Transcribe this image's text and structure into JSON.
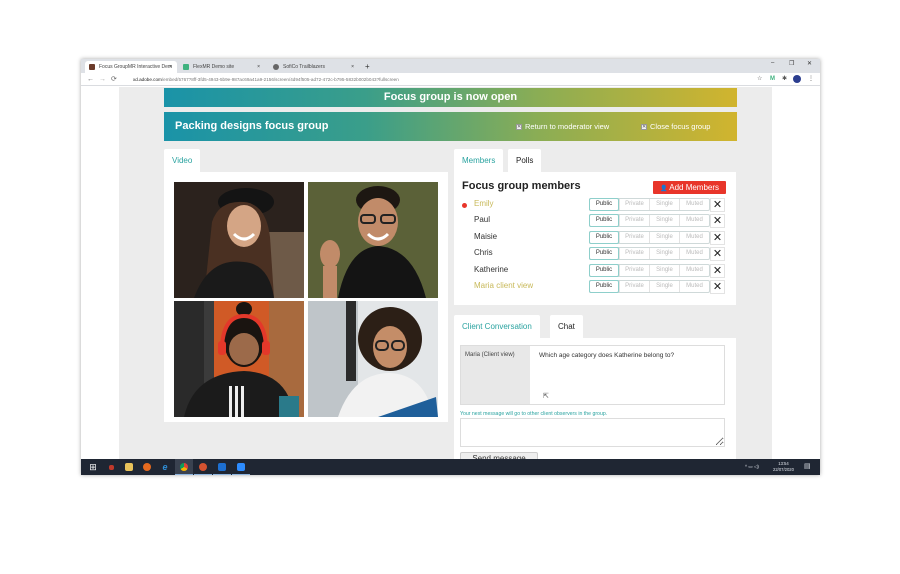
{
  "browser": {
    "tabs": [
      {
        "title": "Focus GroupMR Interactive Dem",
        "active": true,
        "favicon_color": "#6b3b2a"
      },
      {
        "title": "FlexMR Demo site",
        "active": false,
        "favicon_color": "#3fb27f"
      },
      {
        "title": "SofiCo Trailblazers",
        "active": false,
        "favicon_color": "#555555"
      }
    ],
    "new_tab_label": "+",
    "tab_close_glyph": "×",
    "window_controls": {
      "minimize": "–",
      "restore": "❐",
      "close": "✕"
    },
    "nav": {
      "back": "←",
      "forward": "→",
      "reload": "⟳",
      "lock": "🔒"
    },
    "url_host": "xd.adobe.com",
    "url_path": "/embed/5767?8ff-3fd5-4943-5b9e-987ac69a41a9-2156/screen/4d94f505-ad72-472c-b795-5832b002b043?fullscreen",
    "toolbar_icons": {
      "star": "☆",
      "extension_m": "M",
      "puzzle": "✱",
      "profile": "P",
      "menu": "⋮"
    }
  },
  "app": {
    "status_banner": "Focus group is now open",
    "group_title": "Packing designs focus group",
    "return_label": "Return to moderator view",
    "close_label": "Close focus group",
    "x_glyph": "✕",
    "accent_colors": {
      "teal": "#1a93a8",
      "gold": "#d1b42e",
      "red": "#e8352a",
      "tab_teal": "#2aa3a0"
    }
  },
  "video": {
    "tab_label": "Video",
    "tiles": [
      {
        "description": "woman with black hat laughing"
      },
      {
        "description": "man with glasses smiling"
      },
      {
        "description": "person with red headphones reading"
      },
      {
        "description": "woman with curly hair and glasses"
      }
    ]
  },
  "members": {
    "tabs": [
      {
        "label": "Members",
        "active": true
      },
      {
        "label": "Polls",
        "active": false
      }
    ],
    "title": "Focus group members",
    "add_label": "Add Members",
    "add_icon": "👤",
    "modes": [
      "Public",
      "Private",
      "Single",
      "Muted"
    ],
    "remove_glyph": "✕",
    "list": [
      {
        "name": "Emily",
        "highlight": true,
        "online_dot": true,
        "mode": "Public"
      },
      {
        "name": "Paul",
        "highlight": false,
        "online_dot": false,
        "mode": "Public"
      },
      {
        "name": "Maisie",
        "highlight": false,
        "online_dot": false,
        "mode": "Public"
      },
      {
        "name": "Chris",
        "highlight": false,
        "online_dot": false,
        "mode": "Public"
      },
      {
        "name": "Katherine",
        "highlight": false,
        "online_dot": false,
        "mode": "Public"
      },
      {
        "name": "Maria client view",
        "highlight": true,
        "online_dot": false,
        "mode": "Public"
      }
    ]
  },
  "chat": {
    "tabs": [
      {
        "label": "Client Conversation",
        "active": true
      },
      {
        "label": "Chat",
        "active": false
      }
    ],
    "messages": [
      {
        "sender": "Maria (Client view)",
        "text": "Which age category does Katherine belong to?"
      }
    ],
    "hint": "Your next message will go to other client observers in the group.",
    "reply_value": "",
    "send_label": "Send message",
    "cursor_glyph": "⇱"
  },
  "taskbar": {
    "start_glyph": "⊞",
    "apps": [
      {
        "name": "task-app",
        "color": "#c0392b",
        "state": "idle"
      },
      {
        "name": "file-explorer",
        "color": "#e8c25a",
        "state": "idle"
      },
      {
        "name": "firefox",
        "color": "#e66a1f",
        "state": "idle"
      },
      {
        "name": "internet-explorer",
        "color": "#2f8fd8",
        "state": "idle"
      },
      {
        "name": "chrome",
        "color": "#4caf50",
        "state": "active"
      },
      {
        "name": "powerpoint",
        "color": "#d35230",
        "state": "running"
      },
      {
        "name": "outlook",
        "color": "#1d6fd1",
        "state": "running"
      },
      {
        "name": "zoom",
        "color": "#2d8cff",
        "state": "running"
      }
    ],
    "tray": "^ ▭ ◁)",
    "time": "13:54",
    "date": "22/07/2020",
    "notification_glyph": "▤"
  }
}
